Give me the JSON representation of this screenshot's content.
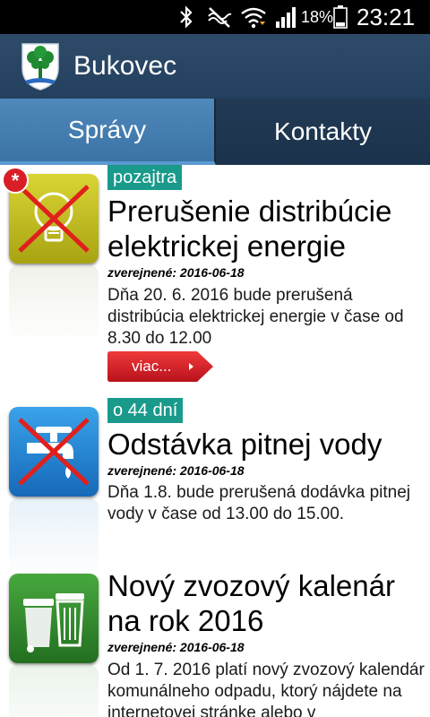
{
  "status_bar": {
    "battery_percent": "18%",
    "time": "23:21",
    "icons": [
      "bluetooth-icon",
      "mute-icon",
      "wifi-icon",
      "signal-icon",
      "battery-icon"
    ]
  },
  "app_bar": {
    "title": "Bukovec",
    "logo_icon": "coat-of-arms-icon"
  },
  "tabs": [
    {
      "label": "Správy",
      "active": true
    },
    {
      "label": "Kontakty",
      "active": false
    }
  ],
  "news": [
    {
      "badge": "pozajtra",
      "title": "Prerušenie distribúcie elektrickej energie",
      "date": "zverejnené: 2016-06-18",
      "description": "Dňa 20. 6. 2016 bude prerušená distribúcia elektrickej energie v čase od 8.30 do 12.00",
      "more_label": "viac...",
      "icon": "lightbulb-crossed-icon",
      "is_new": "*"
    },
    {
      "badge": "o 44 dní",
      "title": "Odstávka pitnej vody",
      "date": "zverejnené: 2016-06-18",
      "description": "Dňa 1.8. bude prerušená dodávka pitnej vody v čase od 13.00 do 15.00.",
      "icon": "water-tap-crossed-icon"
    },
    {
      "title": "Nový zvozový kalenár na rok 2016",
      "date": "zverejnené: 2016-06-18",
      "description": "Od 1. 7. 2016 platí nový zvozový kalendár komunálneho odpadu, ktorý nájdete na internetovej stránke alebo v",
      "icon": "waste-bins-icon"
    }
  ],
  "colors": {
    "app_bar": "#2e4b6a",
    "tab_active": "#4f88bb",
    "tab_inactive": "#1b324b",
    "badge": "#199a8b",
    "more_button": "#d81e27",
    "icon_yellow": "#c8c41e",
    "icon_blue": "#1f8bd8",
    "icon_green": "#2f8a2a"
  }
}
